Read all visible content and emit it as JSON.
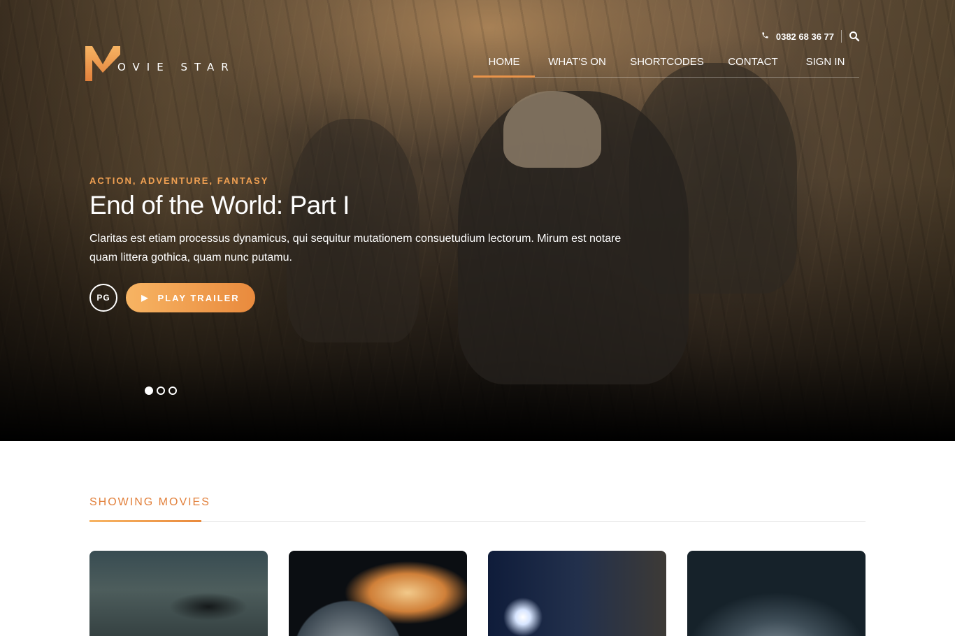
{
  "header": {
    "logo_text": "OVIE STAR",
    "logo_letter": "M",
    "phone": "0382 68 36 77",
    "phone_icon": "phone-icon",
    "search_icon": "search-icon"
  },
  "nav": {
    "items": [
      {
        "label": "HOME",
        "active": true
      },
      {
        "label": "WHAT'S ON",
        "active": false
      },
      {
        "label": "SHORTCODES",
        "active": false
      },
      {
        "label": "CONTACT",
        "active": false
      },
      {
        "label": "SIGN IN",
        "active": false
      }
    ]
  },
  "hero": {
    "genres": "ACTION, ADVENTURE, FANTASY",
    "title": "End of the World: Part I",
    "description": "Claritas est etiam processus dynamicus, qui sequitur mutationem consuetudium lectorum. Mirum est notare quam littera gothica, quam nunc putamu.",
    "rating": "PG",
    "play_label": "PLAY TRAILER",
    "play_icon": "play-icon",
    "slides": 3,
    "active_slide": 1
  },
  "section": {
    "title": "SHOWING MOVIES"
  },
  "colors": {
    "accent": "#e9944a",
    "accent_light": "#f7b463",
    "section_title": "#e2803b"
  }
}
